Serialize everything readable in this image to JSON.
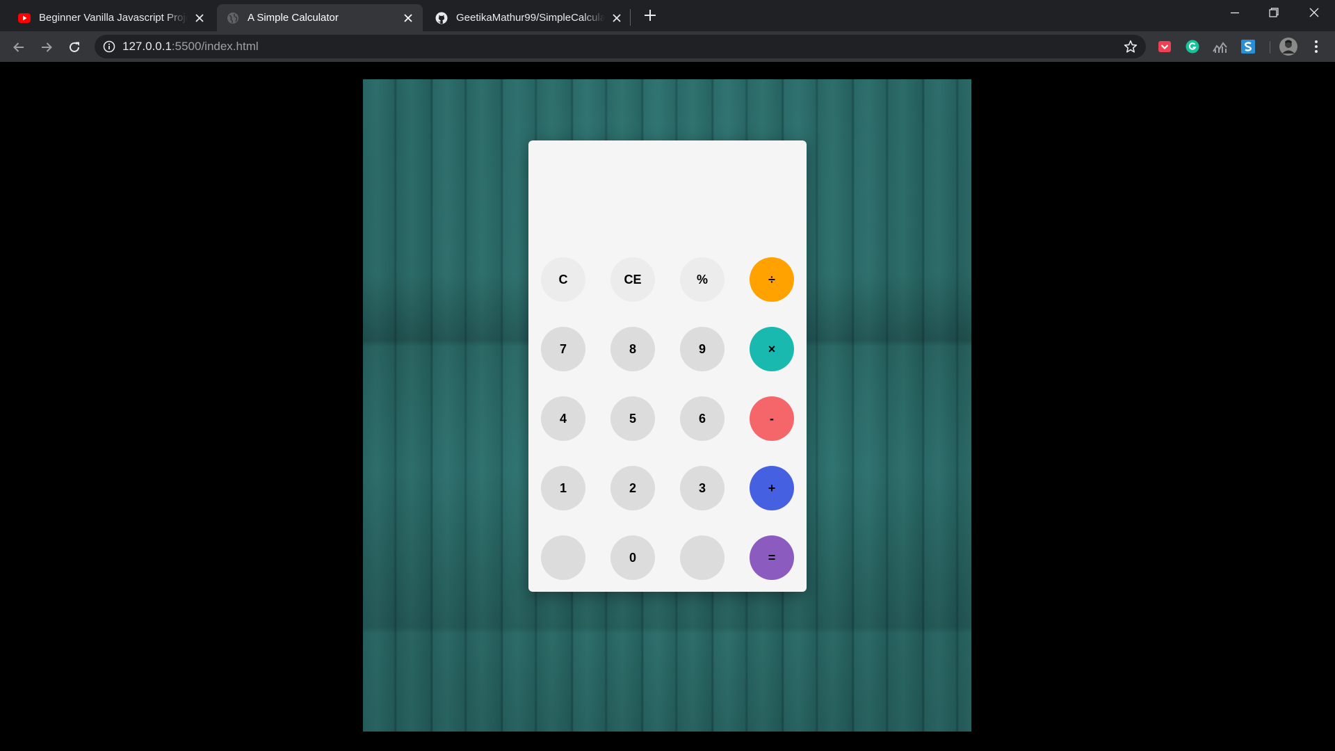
{
  "browser": {
    "tabs": [
      {
        "title": "Beginner Vanilla Javascript Projec",
        "icon": "youtube-icon",
        "active": false
      },
      {
        "title": "A Simple Calculator",
        "icon": "globe-icon",
        "active": true
      },
      {
        "title": "GeetikaMathur99/SimpleCalculat",
        "icon": "github-icon",
        "active": false
      }
    ],
    "url": {
      "host": "127.0.0.1",
      "path": ":5500/index.html"
    },
    "extensions": [
      "pocket-icon",
      "grammarly-icon",
      "analytics-icon",
      "s-extension-icon",
      "profile-avatar"
    ]
  },
  "calculator": {
    "display": "",
    "rows": [
      [
        {
          "label": "C",
          "color": "#ececec"
        },
        {
          "label": "CE",
          "color": "#ececec"
        },
        {
          "label": "%",
          "color": "#ececec"
        },
        {
          "label": "÷",
          "color": "#ffa200"
        }
      ],
      [
        {
          "label": "7",
          "color": "#dcdcdc"
        },
        {
          "label": "8",
          "color": "#dcdcdc"
        },
        {
          "label": "9",
          "color": "#dcdcdc"
        },
        {
          "label": "×",
          "color": "#1ab9b0"
        }
      ],
      [
        {
          "label": "4",
          "color": "#dcdcdc"
        },
        {
          "label": "5",
          "color": "#dcdcdc"
        },
        {
          "label": "6",
          "color": "#dcdcdc"
        },
        {
          "label": "-",
          "color": "#f5666b"
        }
      ],
      [
        {
          "label": "1",
          "color": "#dcdcdc"
        },
        {
          "label": "2",
          "color": "#dcdcdc"
        },
        {
          "label": "3",
          "color": "#dcdcdc"
        },
        {
          "label": "+",
          "color": "#4560e0"
        }
      ],
      [
        {
          "label": "",
          "color": "#dcdcdc"
        },
        {
          "label": "0",
          "color": "#dcdcdc"
        },
        {
          "label": "",
          "color": "#dcdcdc"
        },
        {
          "label": "=",
          "color": "#8b5bbf"
        }
      ]
    ]
  }
}
